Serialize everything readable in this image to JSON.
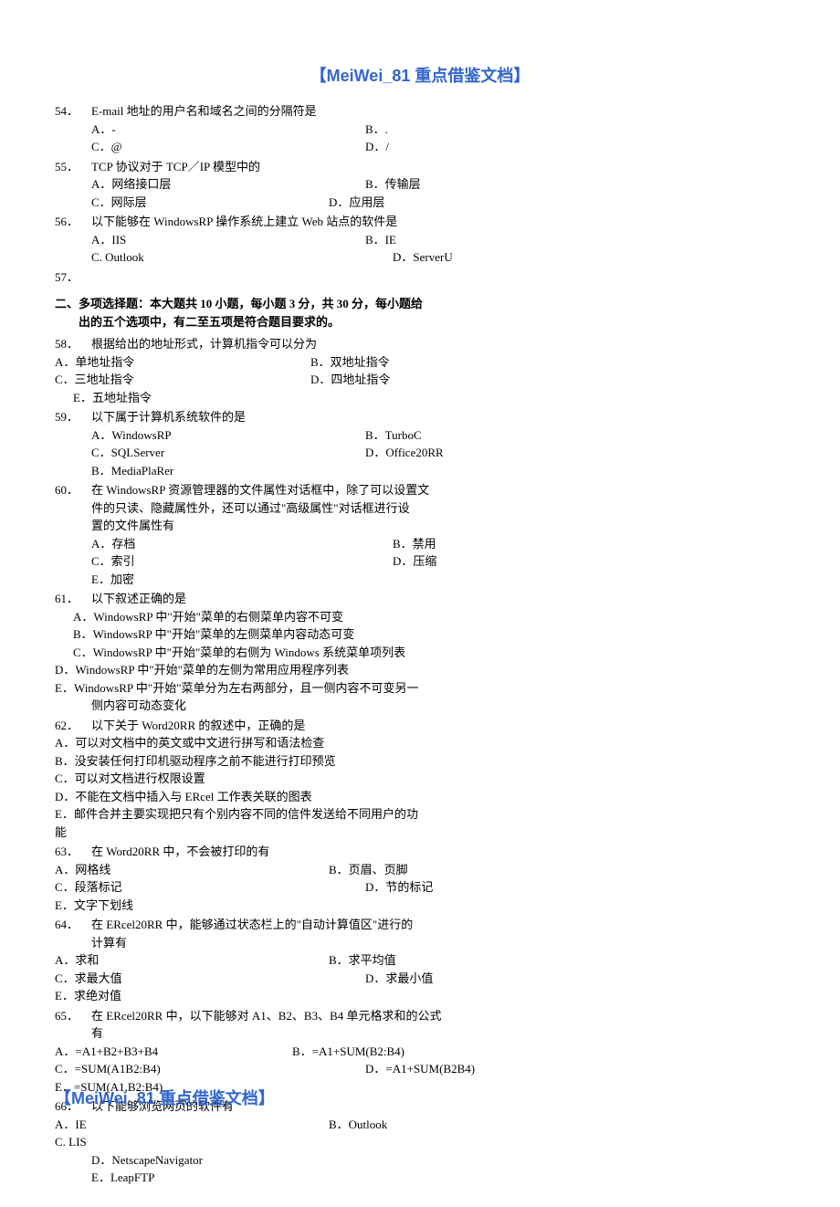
{
  "header": "【MeiWei_81 重点借鉴文档】",
  "footer": "【MeiWei_81 重点借鉴文档】",
  "section2_title_line1": "二、多项选择题：本大题共 10 小题，每小题 3 分，共 30 分，每小题给",
  "section2_title_line2": "出的五个选项中，有二至五项是符合题目要求的。",
  "q54": {
    "num": "54．",
    "text": "E-mail 地址的用户名和域名之间的分隔符是",
    "a": "A．-",
    "b": "B．.",
    "c": "C．@",
    "d": "D．/"
  },
  "q55": {
    "num": "55．",
    "text": "TCP 协议对于 TCP／IP 模型中的",
    "a": "A．网络接口层",
    "b": "B．传输层",
    "c": "C．网际层",
    "d": "D．应用层"
  },
  "q56": {
    "num": "56．",
    "text": "以下能够在 WindowsRP 操作系统上建立 Web 站点的软件是",
    "a": "A．IIS",
    "b": "B．IE",
    "c": "C. Outlook",
    "d": "D．ServerU"
  },
  "q57": {
    "num": "57．"
  },
  "q58": {
    "num": "58．",
    "text": "根据给出的地址形式，计算机指令可以分为",
    "a": "A．单地址指令",
    "b": "B．双地址指令",
    "c": "C．三地址指令",
    "d": "D．四地址指令",
    "e": "E．五地址指令"
  },
  "q59": {
    "num": "59．",
    "text": "以下属于计算机系统软件的是",
    "a": "A．WindowsRP",
    "b": "B．TurboC",
    "c": "C．SQLServer",
    "d": "D．Office20RR",
    "e": "B．MediaPlaRer"
  },
  "q60": {
    "num": "60．",
    "text1": "在 WindowsRP 资源管理器的文件属性对话框中，除了可以设置文",
    "text2": "件的只读、隐藏属性外，还可以通过\"高级属性\"对话框进行设",
    "text3": "置的文件属性有",
    "a": "A．存档",
    "b": "B．禁用",
    "c": "C．索引",
    "d": "D．压缩",
    "e": "E．加密"
  },
  "q61": {
    "num": "61．",
    "text": "以下叙述正确的是",
    "a": "A．WindowsRP 中\"开始\"菜单的右侧菜单内容不可变",
    "b": "B．WindowsRP 中\"开始\"菜单的左侧菜单内容动态可变",
    "c": "C．WindowsRP 中\"开始\"菜单的右侧为 Windows 系统菜单项列表",
    "d": "D．WindowsRP 中\"开始\"菜单的左侧为常用应用程序列表",
    "e1": "E．WindowsRP 中\"开始\"菜单分为左右两部分，且一侧内容不可变另一",
    "e2": "侧内容可动态变化"
  },
  "q62": {
    "num": "62．",
    "text": "以下关于 Word20RR 的叙述中，正确的是",
    "a": "A．可以对文档中的英文或中文进行拼写和语法检查",
    "b": "B．没安装任何打印机驱动程序之前不能进行打印预览",
    "c": "C．可以对文档进行权限设置",
    "d": "D．不能在文档中插入与 ERcel 工作表关联的图表",
    "e1": "E．邮件合并主要实现把只有个别内容不同的信件发送给不同用户的功",
    "e2": "能"
  },
  "q63": {
    "num": "63．",
    "text": "在 Word20RR 中，不会被打印的有",
    "a": "A．网格线",
    "b": "B．页眉、页脚",
    "c": "C．段落标记",
    "d": "D．节的标记",
    "e": "E．文字下划线"
  },
  "q64": {
    "num": "64．",
    "text1": "在 ERcel20RR 中，能够通过状态栏上的\"自动计算值区\"进行的",
    "text2": "计算有",
    "a": "A．求和",
    "b": "B．求平均值",
    "c": "C．求最大值",
    "d": "D．求最小值",
    "e": "E．求绝对值"
  },
  "q65": {
    "num": "65．",
    "text1": "在 ERcel20RR 中，以下能够对 A1、B2、B3、B4 单元格求和的公式",
    "text2": "有",
    "a": "A．=A1+B2+B3+B4",
    "b": "B．=A1+SUM(B2:B4)",
    "c": "C．=SUM(A1B2:B4)",
    "d": "D．=A1+SUM(B2B4)",
    "e": "E．=SUM(A1,B2:B4)"
  },
  "q66": {
    "num": "66．",
    "text": "以下能够浏览网页的软件有",
    "a": "A．IE",
    "b": "B．Outlook",
    "c": "C. LIS",
    "d": "D．NetscapeNavigator",
    "e": "E．LeapFTP"
  }
}
